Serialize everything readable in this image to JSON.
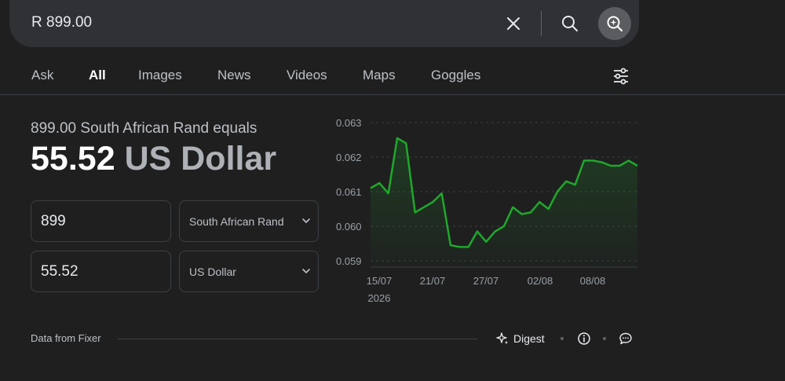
{
  "search": {
    "query": "R 899.00"
  },
  "tabs": [
    {
      "label": "Ask"
    },
    {
      "label": "All"
    },
    {
      "label": "Images"
    },
    {
      "label": "News"
    },
    {
      "label": "Videos"
    },
    {
      "label": "Maps"
    },
    {
      "label": "Goggles"
    }
  ],
  "active_tab": "All",
  "converter": {
    "subtitle": "899.00 South African Rand equals",
    "result_amount": "55.52",
    "result_unit": "US Dollar",
    "from_value": "899",
    "from_currency": "South African Rand",
    "to_value": "55.52",
    "to_currency": "US Dollar"
  },
  "chart_data": {
    "type": "area",
    "line_color": "#1fa82b",
    "y_ticks": [
      "0.063",
      "0.062",
      "0.061",
      "0.060",
      "0.059"
    ],
    "ylim": [
      0.0588,
      0.0632
    ],
    "x_ticks": [
      {
        "label": "15/07",
        "sub": "2026"
      },
      {
        "label": "21/07",
        "sub": ""
      },
      {
        "label": "27/07",
        "sub": ""
      },
      {
        "label": "02/08",
        "sub": ""
      },
      {
        "label": "08/08",
        "sub": ""
      }
    ],
    "values": [
      0.0611,
      0.06125,
      0.06095,
      0.06255,
      0.0624,
      0.0604,
      0.06055,
      0.0607,
      0.06095,
      0.05945,
      0.0594,
      0.0594,
      0.05985,
      0.05955,
      0.05985,
      0.06,
      0.06055,
      0.06035,
      0.0604,
      0.0607,
      0.0605,
      0.061,
      0.0613,
      0.0612,
      0.0619,
      0.0619,
      0.06185,
      0.06175,
      0.06175,
      0.0619,
      0.06175
    ],
    "grid": true,
    "gridline_style": "dashed"
  },
  "footer": {
    "source": "Data from Fixer",
    "digest_label": "Digest"
  },
  "icons": {
    "clear": "close-icon",
    "search": "search-icon",
    "lens": "visual-search-icon",
    "tools": "sliders-icon",
    "digest": "sparkle-icon",
    "info": "info-icon",
    "feedback": "feedback-icon"
  }
}
